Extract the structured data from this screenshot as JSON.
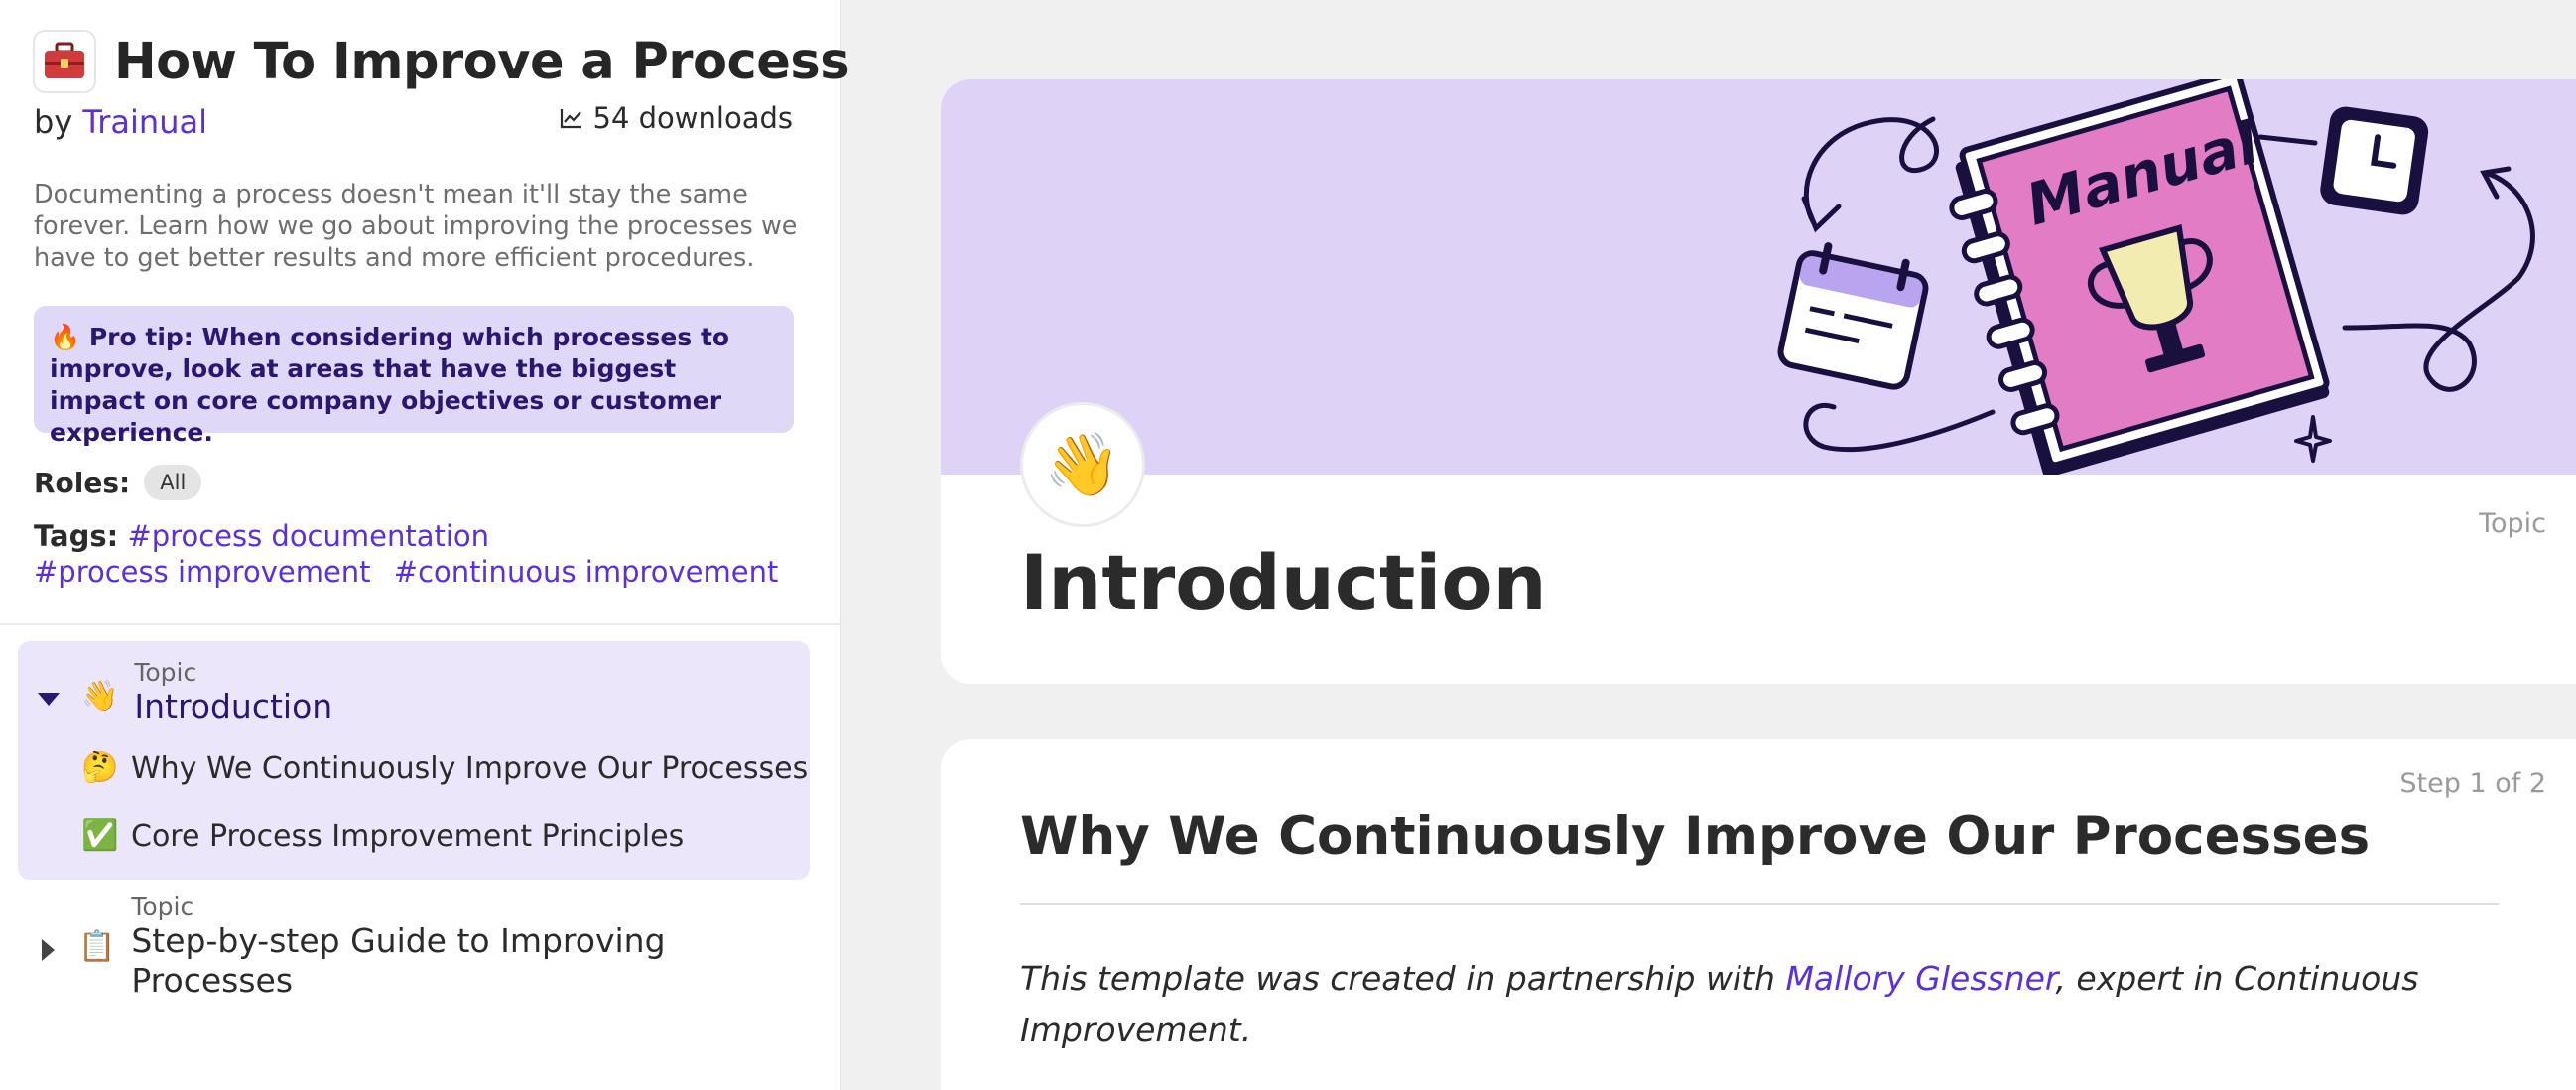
{
  "template": {
    "title": "How To Improve a Process",
    "by_prefix": "by",
    "author": "Trainual",
    "downloads": "54 downloads",
    "description": "Documenting a process doesn't mean it'll stay the same forever. Learn how we go about improving the processes we have to get better results and more efficient procedures.",
    "pro_tip": "🔥 Pro tip: When considering which processes to improve, look at areas that have the biggest impact on core company objectives or customer experience.",
    "roles_label": "Roles:",
    "roles": [
      "All"
    ],
    "tags_label": "Tags:",
    "tags": [
      "#process documentation",
      "#process improvement",
      "#continuous improvement"
    ]
  },
  "outline": {
    "topics": [
      {
        "kicker": "Topic",
        "emoji": "👋",
        "name": "Introduction",
        "expanded": true,
        "steps": [
          {
            "emoji": "🤔",
            "label": "Why We Continuously Improve Our Processes"
          },
          {
            "emoji": "✅",
            "label": "Core Process Improvement Principles"
          }
        ]
      },
      {
        "kicker": "Topic",
        "emoji": "📋",
        "name": "Step-by-step Guide to Improving Processes",
        "expanded": false,
        "steps": []
      }
    ]
  },
  "hero": {
    "kicker": "Topic",
    "emoji": "👋",
    "title": "Introduction",
    "illustration_text": "Manual",
    "banner_color": "#ded3f6"
  },
  "step": {
    "counter": "Step 1 of 2",
    "title": "Why We Continuously Improve Our Processes",
    "body_before": "This template was created in partnership with ",
    "body_link": "Mallory Glessner",
    "body_after": ", expert in Continuous Improvement."
  },
  "colors": {
    "accent": "#5b2ee0",
    "accent_dark": "#2b1670",
    "selected_bg": "#ece6fb"
  }
}
